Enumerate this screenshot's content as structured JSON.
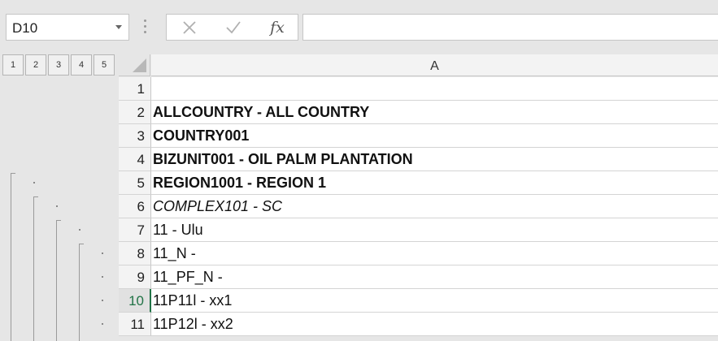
{
  "namebox": {
    "value": "D10"
  },
  "formula_bar": {
    "fx_label": "fx",
    "value": ""
  },
  "outline": {
    "levels": [
      "1",
      "2",
      "3",
      "4",
      "5"
    ]
  },
  "columns": [
    "A"
  ],
  "rows": [
    {
      "num": "1",
      "text": ""
    },
    {
      "num": "2",
      "text": "ALLCOUNTRY - ALL COUNTRY"
    },
    {
      "num": "3",
      "text": "COUNTRY001"
    },
    {
      "num": "4",
      "text": "BIZUNIT001 - OIL PALM PLANTATION"
    },
    {
      "num": "5",
      "text": "REGION1001 - REGION 1"
    },
    {
      "num": "6",
      "text": "COMPLEX101 - SC"
    },
    {
      "num": "7",
      "text": "11 - Ulu"
    },
    {
      "num": "8",
      "text": "11_N -"
    },
    {
      "num": "9",
      "text": "11_PF_N -"
    },
    {
      "num": "10",
      "text": "11P11l - xx1"
    },
    {
      "num": "11",
      "text": "11P12l - xx2"
    }
  ],
  "colors": {
    "accent": "#217346",
    "header_bg": "#f3f3f3",
    "gridline": "#d4d4d4"
  }
}
